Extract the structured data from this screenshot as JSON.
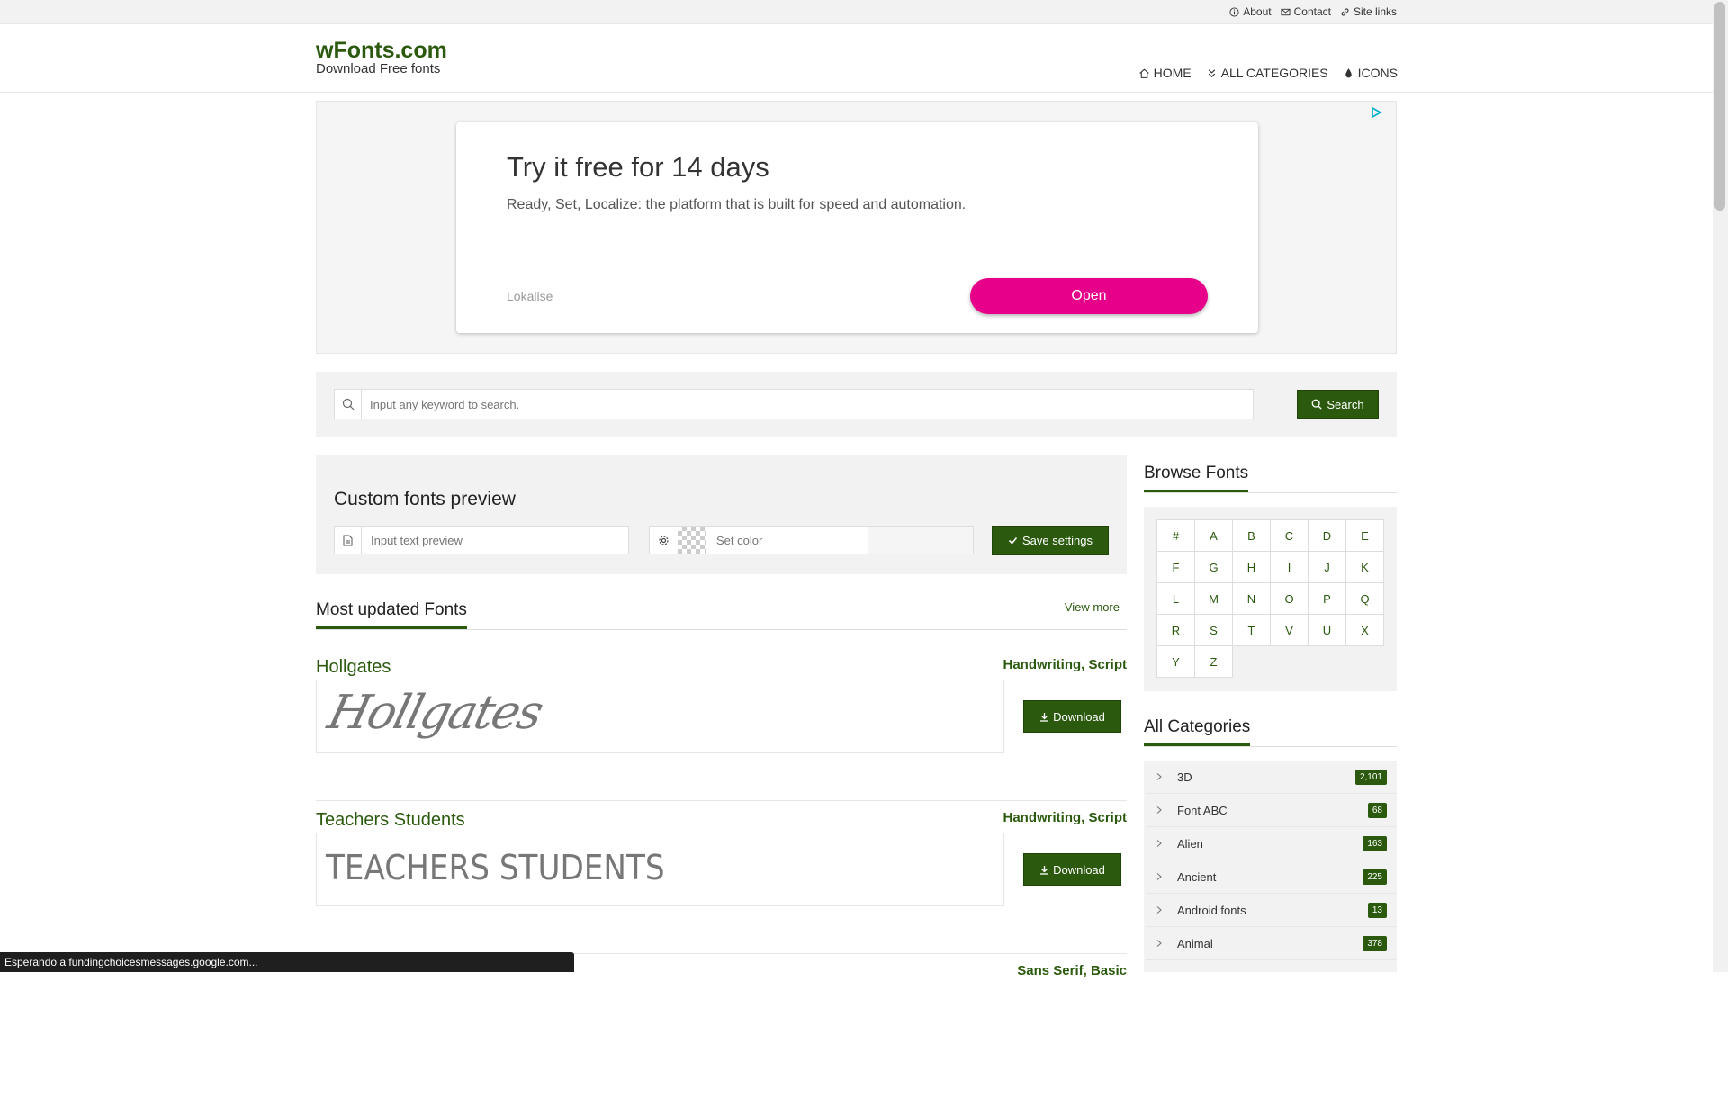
{
  "topbar": {
    "about": "About",
    "contact": "Contact",
    "site_links": "Site links"
  },
  "header": {
    "logo_title": "wFonts.com",
    "logo_subtitle": "Download Free fonts",
    "nav": {
      "home": "HOME",
      "all_categories": "ALL CATEGORIES",
      "icons": "ICONS"
    }
  },
  "ad": {
    "title": "Try it free for 14 days",
    "text": "Ready, Set, Localize: the platform that is built for speed and automation.",
    "brand": "Lokalise",
    "button": "Open",
    "button_color": "#e6008a"
  },
  "search": {
    "placeholder": "Input any keyword to search.",
    "button": "Search"
  },
  "preview": {
    "title": "Custom fonts preview",
    "text_placeholder": "Input text preview",
    "color_placeholder": "Set color",
    "save": "Save settings"
  },
  "most_updated": {
    "title": "Most updated Fonts",
    "view_more": "View more",
    "fonts": [
      {
        "name": "Hollgates",
        "categories": "Handwriting, Script",
        "preview": "Hollgates",
        "download": "Download"
      },
      {
        "name": "Teachers Students",
        "categories": "Handwriting, Script",
        "preview": "TEACHERS STUDENTS",
        "download": "Download"
      },
      {
        "name": "",
        "categories": "Sans Serif, Basic",
        "preview": "",
        "download": ""
      }
    ]
  },
  "sidebar": {
    "browse_title": "Browse Fonts",
    "alphabet": [
      "#",
      "A",
      "B",
      "C",
      "D",
      "E",
      "F",
      "G",
      "H",
      "I",
      "J",
      "K",
      "L",
      "M",
      "N",
      "O",
      "P",
      "Q",
      "R",
      "S",
      "T",
      "V",
      "U",
      "X",
      "Y",
      "Z"
    ],
    "categories_title": "All Categories",
    "categories": [
      {
        "name": "3D",
        "count": "2,101"
      },
      {
        "name": "Font ABC",
        "count": "68"
      },
      {
        "name": "Alien",
        "count": "163"
      },
      {
        "name": "Ancient",
        "count": "225"
      },
      {
        "name": "Android fonts",
        "count": "13"
      },
      {
        "name": "Animal",
        "count": "378"
      }
    ]
  },
  "statusbar": {
    "text": "Esperando a fundingchoicesmessages.google.com..."
  },
  "colors": {
    "brand_green": "#2b5a0f",
    "ad_button": "#e6008a"
  },
  "icons": [
    "info-icon",
    "mail-icon",
    "link-icon",
    "home-icon",
    "chevrons-down-icon",
    "drop-icon",
    "ad-choices-icon",
    "search-icon",
    "document-icon",
    "gear-icon",
    "check-icon",
    "download-icon",
    "chevron-right-icon"
  ]
}
